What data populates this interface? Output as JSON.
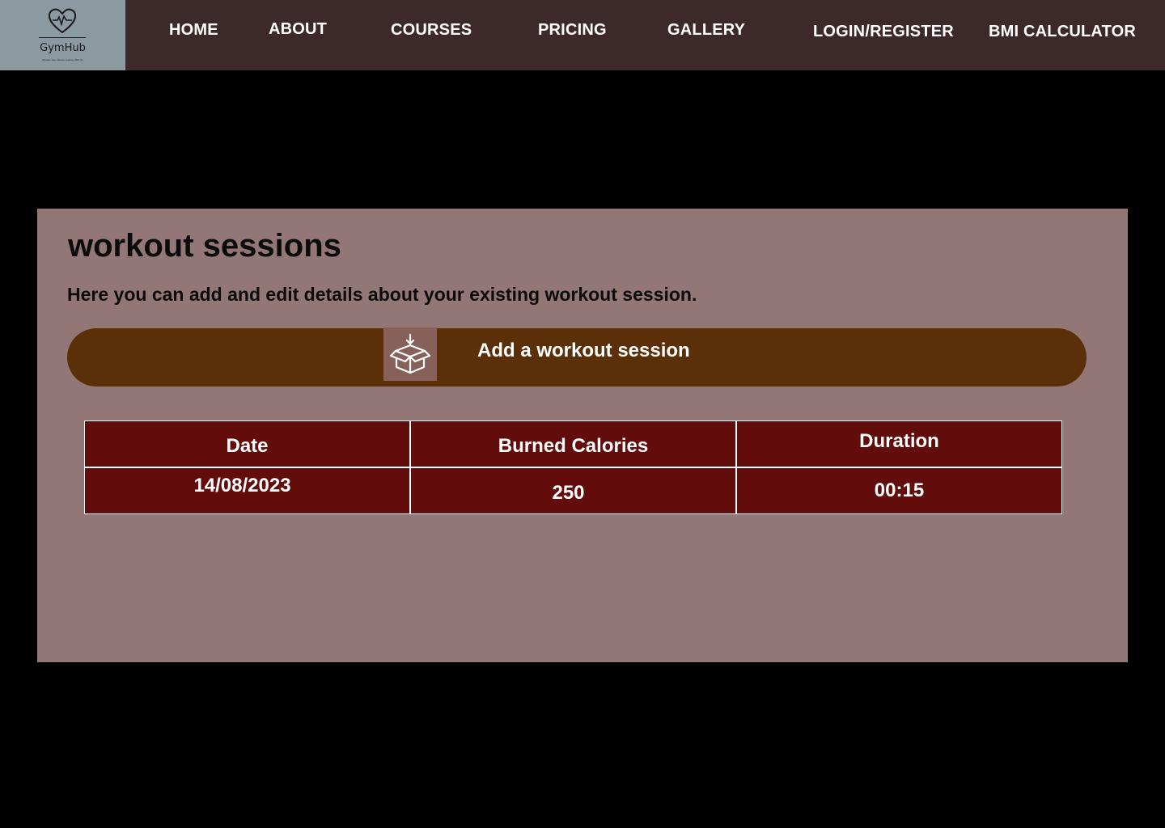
{
  "logo": {
    "name": "GymHub",
    "tagline": "Elevate Your Fitness Journey With Us"
  },
  "nav": {
    "items": [
      {
        "label": "HOME"
      },
      {
        "label": "ABOUT"
      },
      {
        "label": "COURSES"
      },
      {
        "label": "PRICING"
      },
      {
        "label": "GALLERY"
      },
      {
        "label": "LOGIN/REGISTER"
      },
      {
        "label": "BMI CALCULATOR"
      }
    ]
  },
  "main": {
    "title": "workout sessions",
    "description": "Here you can add and edit details about your existing workout session.",
    "add_button": {
      "label": "Add a workout session",
      "icon": "box-download-icon"
    },
    "table": {
      "headers": [
        "Date",
        "Burned Calories",
        "Duration"
      ],
      "rows": [
        [
          "14/08/2023",
          "250",
          "00:15"
        ]
      ]
    }
  },
  "colors": {
    "navbar": "#3d2929",
    "logo_bg": "#8b99a1",
    "panel": "#937777",
    "button": "#5b3009",
    "icon_bg": "#876159",
    "table_cell": "#630c0c"
  }
}
